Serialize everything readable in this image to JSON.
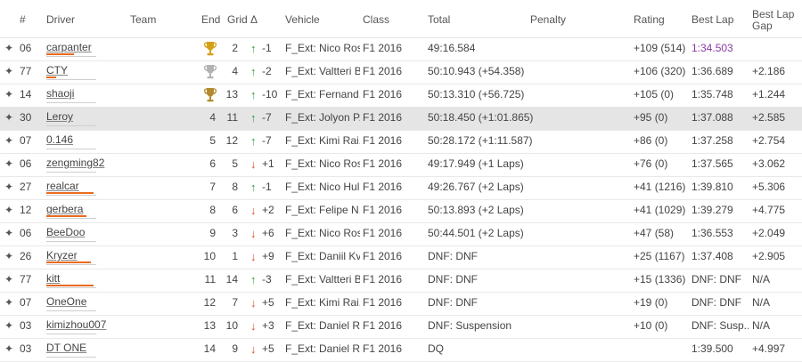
{
  "headers": {
    "num": "#",
    "driver": "Driver",
    "team": "Team",
    "end": "End",
    "grid": "Grid",
    "delta": "Δ",
    "vehicle": "Vehicle",
    "class": "Class",
    "total": "Total",
    "penalty": "Penalty",
    "rating": "Rating",
    "best_lap": "Best Lap",
    "best_lap_gap_1": "Best Lap",
    "best_lap_gap_2": "Gap"
  },
  "expand_symbol": "✦",
  "arrows": {
    "up": "↑",
    "down": "↓"
  },
  "colors": {
    "gold": "#d4a017",
    "silver": "#b3b3b3",
    "bronze": "#b38a2d",
    "bar": "#ea6a1e",
    "up": "#2f9a3a",
    "down": "#e2462c",
    "best_lap_highlight": "#8a3aa4"
  },
  "rows": [
    {
      "num": "06",
      "driver": "carpanter",
      "bar": 0.55,
      "end": "",
      "trophy": "gold",
      "grid": "2",
      "dir": "up",
      "delta": "-1",
      "vehicle": "F_Ext: Nico Ros...",
      "class": "F1 2016",
      "total": "49:16.584",
      "penalty": "",
      "rating": "+109 (514)",
      "best_lap": "1:34.503",
      "best_lap_purple": true,
      "gap": ""
    },
    {
      "num": "77",
      "driver": "CTY",
      "bar": 0.2,
      "end": "",
      "trophy": "silver",
      "grid": "4",
      "dir": "up",
      "delta": "-2",
      "vehicle": "F_Ext: Valtteri B...",
      "class": "F1 2016",
      "total": "50:10.943 (+54.358)",
      "penalty": "",
      "rating": "+106 (320)",
      "best_lap": "1:36.689",
      "gap": "+2.186"
    },
    {
      "num": "14",
      "driver": "shaoji",
      "bar": 0.0,
      "end": "",
      "trophy": "bronze",
      "grid": "13",
      "dir": "up",
      "delta": "-10",
      "vehicle": "F_Ext: Fernand...",
      "class": "F1 2016",
      "total": "50:13.310 (+56.725)",
      "penalty": "",
      "rating": "+105 (0)",
      "best_lap": "1:35.748",
      "gap": "+1.244"
    },
    {
      "num": "30",
      "driver": "Leroy",
      "bar": 0.0,
      "end": "4",
      "trophy": "",
      "grid": "11",
      "dir": "up",
      "delta": "-7",
      "vehicle": "F_Ext: Jolyon P...",
      "class": "F1 2016",
      "total": "50:18.450 (+1:01.865)",
      "penalty": "",
      "rating": "+95 (0)",
      "best_lap": "1:37.088",
      "gap": "+2.585"
    },
    {
      "num": "07",
      "driver": "0.146",
      "bar": 0.0,
      "end": "5",
      "trophy": "",
      "grid": "12",
      "dir": "up",
      "delta": "-7",
      "vehicle": "F_Ext: Kimi Rai...",
      "class": "F1 2016",
      "total": "50:28.172 (+1:11.587)",
      "penalty": "",
      "rating": "+86 (0)",
      "best_lap": "1:37.258",
      "gap": "+2.754"
    },
    {
      "num": "06",
      "driver": "zengming82",
      "bar": 0.0,
      "end": "6",
      "trophy": "",
      "grid": "5",
      "dir": "down",
      "delta": "+1",
      "vehicle": "F_Ext: Nico Ros...",
      "class": "F1 2016",
      "total": "49:17.949 (+1 Laps)",
      "penalty": "",
      "rating": "+76 (0)",
      "best_lap": "1:37.565",
      "gap": "+3.062"
    },
    {
      "num": "27",
      "driver": "realcar",
      "bar": 0.95,
      "end": "7",
      "trophy": "",
      "grid": "8",
      "dir": "up",
      "delta": "-1",
      "vehicle": "F_Ext: Nico Hul...",
      "class": "F1 2016",
      "total": "49:26.767 (+2 Laps)",
      "penalty": "",
      "rating": "+41 (1216)",
      "best_lap": "1:39.810",
      "gap": "+5.306"
    },
    {
      "num": "12",
      "driver": "gerbera",
      "bar": 0.8,
      "end": "8",
      "trophy": "",
      "grid": "6",
      "dir": "down",
      "delta": "+2",
      "vehicle": "F_Ext: Felipe N...",
      "class": "F1 2016",
      "total": "50:13.893 (+2 Laps)",
      "penalty": "",
      "rating": "+41 (1029)",
      "best_lap": "1:39.279",
      "gap": "+4.775"
    },
    {
      "num": "06",
      "driver": "BeeDoo",
      "bar": 0.0,
      "end": "9",
      "trophy": "",
      "grid": "3",
      "dir": "down",
      "delta": "+6",
      "vehicle": "F_Ext: Nico Ros...",
      "class": "F1 2016",
      "total": "50:44.501 (+2 Laps)",
      "penalty": "",
      "rating": "+47 (58)",
      "best_lap": "1:36.553",
      "gap": "+2.049"
    },
    {
      "num": "26",
      "driver": "Kryzer",
      "bar": 0.9,
      "end": "10",
      "trophy": "",
      "grid": "1",
      "dir": "down",
      "delta": "+9",
      "vehicle": "F_Ext: Daniil Kv...",
      "class": "F1 2016",
      "total": "DNF: DNF",
      "penalty": "",
      "rating": "+25 (1167)",
      "best_lap": "1:37.408",
      "gap": "+2.905"
    },
    {
      "num": "77",
      "driver": "kitt",
      "bar": 0.95,
      "end": "11",
      "trophy": "",
      "grid": "14",
      "dir": "up",
      "delta": "-3",
      "vehicle": "F_Ext: Valtteri B...",
      "class": "F1 2016",
      "total": "DNF: DNF",
      "penalty": "",
      "rating": "+15 (1336)",
      "best_lap": "DNF: DNF",
      "gap": "N/A"
    },
    {
      "num": "07",
      "driver": "OneOne",
      "bar": 0.0,
      "end": "12",
      "trophy": "",
      "grid": "7",
      "dir": "down",
      "delta": "+5",
      "vehicle": "F_Ext: Kimi Rai...",
      "class": "F1 2016",
      "total": "DNF: DNF",
      "penalty": "",
      "rating": "+19 (0)",
      "best_lap": "DNF: DNF",
      "gap": "N/A"
    },
    {
      "num": "03",
      "driver": "kimizhou007",
      "bar": 0.0,
      "end": "13",
      "trophy": "",
      "grid": "10",
      "dir": "down",
      "delta": "+3",
      "vehicle": "F_Ext: Daniel R...",
      "class": "F1 2016",
      "total": "DNF: Suspension",
      "penalty": "",
      "rating": "+10 (0)",
      "best_lap": "DNF: Susp...",
      "gap": "N/A"
    },
    {
      "num": "03",
      "driver": "DT ONE",
      "bar": 0.0,
      "end": "14",
      "trophy": "",
      "grid": "9",
      "dir": "down",
      "delta": "+5",
      "vehicle": "F_Ext: Daniel R...",
      "class": "F1 2016",
      "total": "DQ",
      "penalty": "",
      "rating": "",
      "best_lap": "1:39.500",
      "gap": "+4.997"
    }
  ]
}
